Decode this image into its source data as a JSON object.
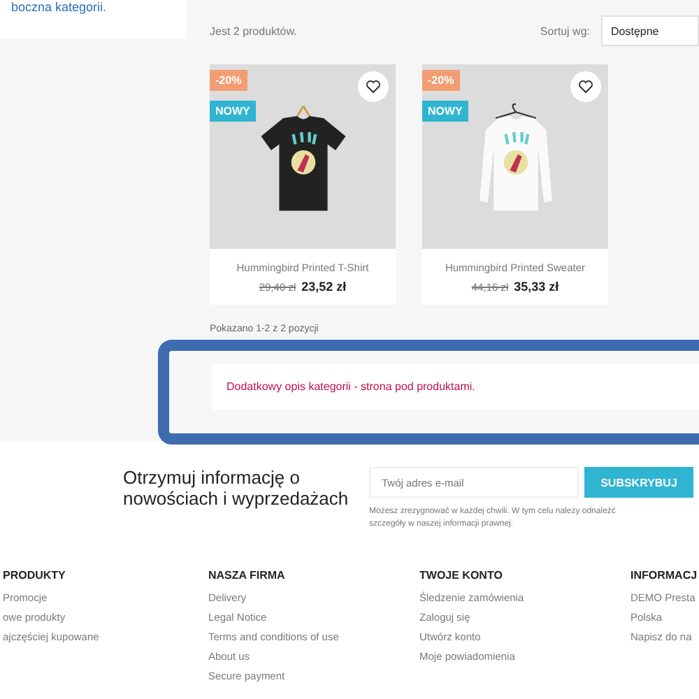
{
  "sidebar": {
    "text": "boczna kategorii."
  },
  "toolbar": {
    "count": "Jest 2 produktów.",
    "sort_label": "Sortuj wg:",
    "sort_value": "Dostępne"
  },
  "products": [
    {
      "kind": "tshirt",
      "discount": "-20%",
      "flag": "NOWY",
      "name": "Hummingbird Printed T-Shirt",
      "old_price": "29,40 zł",
      "price": "23,52 zł"
    },
    {
      "kind": "sweater",
      "discount": "-20%",
      "flag": "NOWY",
      "name": "Hummingbird Printed Sweater",
      "old_price": "44,16 zł",
      "price": "35,33 zł"
    }
  ],
  "pagination": {
    "text": "Pokazano 1-2 z 2 pozycji"
  },
  "category_description": "Dodatkowy opis kategorii - strona pod produktami.",
  "newsletter": {
    "heading": "Otrzymuj informację o nowościach i wyprzedażach",
    "placeholder": "Twój adres e-mail",
    "button": "SUBSKRYBUJ",
    "note": "Możesz zrezygnować w każdej chwili. W tym celu należy odnaleźć szczegóły w naszej informacji prawnej."
  },
  "footer": {
    "columns": [
      {
        "title": "PRODUKTY",
        "links": [
          "Promocje",
          "owe produkty",
          "ajczęściej kupowane"
        ]
      },
      {
        "title": "NASZA FIRMA",
        "links": [
          "Delivery",
          "Legal Notice",
          "Terms and conditions of use",
          "About us",
          "Secure payment"
        ]
      },
      {
        "title": "TWOJE KONTO",
        "links": [
          "Śledzenie zamówienia",
          "Zaloguj się",
          "Utwórz konto",
          "Moje powiadomienia"
        ]
      },
      {
        "title": "INFORMACJ",
        "links": [
          "DEMO Presta",
          "Polska",
          "Napisz do na"
        ]
      }
    ]
  }
}
